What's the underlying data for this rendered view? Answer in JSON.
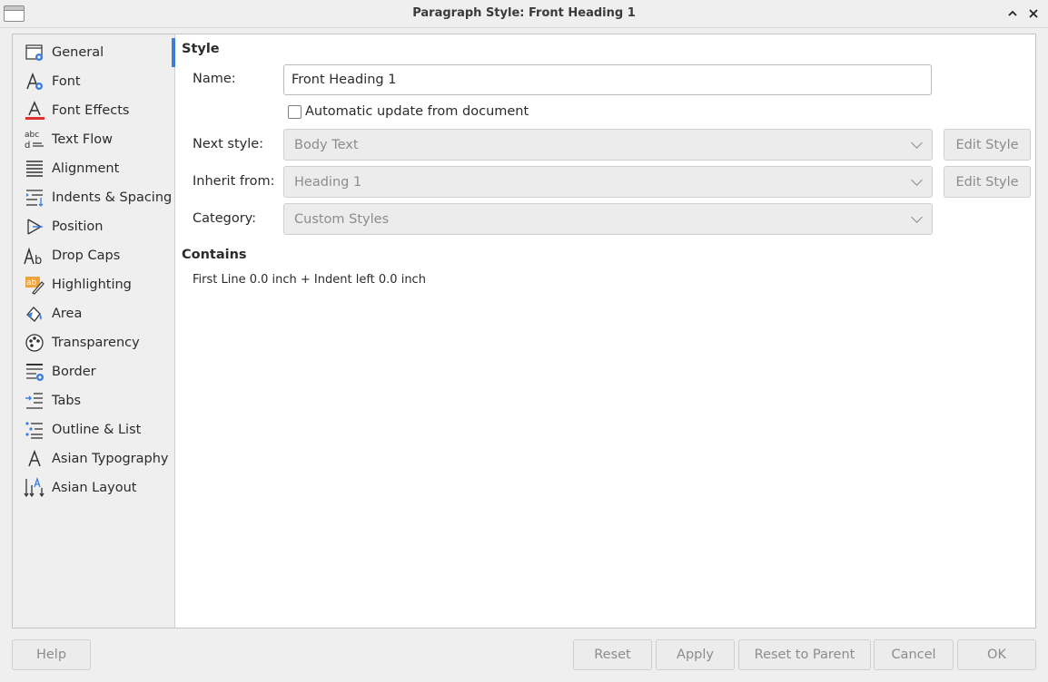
{
  "window": {
    "title": "Paragraph Style: Front Heading 1"
  },
  "sidebar": {
    "items": [
      {
        "label": "General",
        "icon": "general-icon"
      },
      {
        "label": "Font",
        "icon": "font-icon"
      },
      {
        "label": "Font Effects",
        "icon": "font-effects-icon"
      },
      {
        "label": "Text Flow",
        "icon": "text-flow-icon"
      },
      {
        "label": "Alignment",
        "icon": "alignment-icon"
      },
      {
        "label": "Indents & Spacing",
        "icon": "indents-spacing-icon"
      },
      {
        "label": "Position",
        "icon": "position-icon"
      },
      {
        "label": "Drop Caps",
        "icon": "drop-caps-icon"
      },
      {
        "label": "Highlighting",
        "icon": "highlighting-icon"
      },
      {
        "label": "Area",
        "icon": "area-icon"
      },
      {
        "label": "Transparency",
        "icon": "transparency-icon"
      },
      {
        "label": "Border",
        "icon": "border-icon"
      },
      {
        "label": "Tabs",
        "icon": "tabs-icon"
      },
      {
        "label": "Outline & List",
        "icon": "outline-list-icon"
      },
      {
        "label": "Asian Typography",
        "icon": "asian-typography-icon"
      },
      {
        "label": "Asian Layout",
        "icon": "asian-layout-icon"
      }
    ]
  },
  "style": {
    "section_title": "Style",
    "name_label": "Name:",
    "name_value": "Front Heading 1",
    "auto_update_label": "Automatic update from document",
    "next_style_label": "Next style:",
    "next_style_value": "Body Text",
    "inherit_from_label": "Inherit from:",
    "inherit_from_value": "Heading 1",
    "category_label": "Category:",
    "category_value": "Custom Styles",
    "edit_style_label": "Edit Style"
  },
  "contains": {
    "section_title": "Contains",
    "text": "First Line 0.0 inch + Indent left 0.0 inch"
  },
  "buttons": {
    "help": "Help",
    "reset": "Reset",
    "apply": "Apply",
    "reset_to_parent": "Reset to Parent",
    "cancel": "Cancel",
    "ok": "OK"
  },
  "colors": {
    "accent": "#3d7ddb",
    "font_effects_underline": "#e0312f"
  }
}
